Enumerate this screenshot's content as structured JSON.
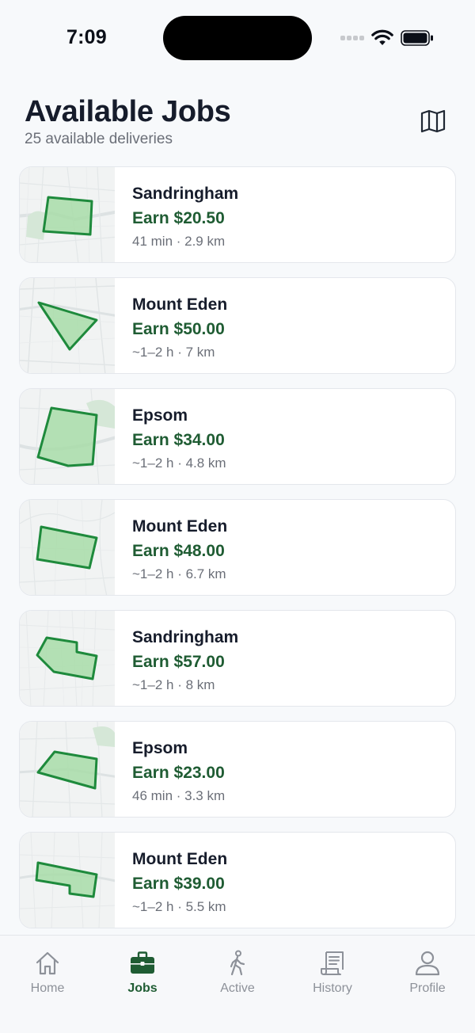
{
  "status_bar": {
    "time": "7:09"
  },
  "header": {
    "title": "Available Jobs",
    "subtitle": "25 available deliveries"
  },
  "jobs": [
    {
      "area": "Sandringham",
      "earn": "Earn $20.50",
      "meta": "41 min · 2.9 km"
    },
    {
      "area": "Mount Eden",
      "earn": "Earn $50.00",
      "meta": "~1–2 h · 7 km"
    },
    {
      "area": "Epsom",
      "earn": "Earn $34.00",
      "meta": "~1–2 h · 4.8 km"
    },
    {
      "area": "Mount Eden",
      "earn": "Earn $48.00",
      "meta": "~1–2 h · 6.7 km"
    },
    {
      "area": "Sandringham",
      "earn": "Earn $57.00",
      "meta": "~1–2 h · 8 km"
    },
    {
      "area": "Epsom",
      "earn": "Earn $23.00",
      "meta": "46 min · 3.3 km"
    },
    {
      "area": "Mount Eden",
      "earn": "Earn $39.00",
      "meta": "~1–2 h · 5.5 km"
    }
  ],
  "tabs": [
    {
      "label": "Home",
      "icon": "home-icon"
    },
    {
      "label": "Jobs",
      "icon": "briefcase-icon",
      "active": true
    },
    {
      "label": "Active",
      "icon": "walking-person-icon"
    },
    {
      "label": "History",
      "icon": "receipt-icon"
    },
    {
      "label": "Profile",
      "icon": "person-icon"
    }
  ],
  "colors": {
    "accent": "#1f5c33",
    "zone_fill": "#a8dca8",
    "zone_stroke": "#1e8a3c",
    "text_primary": "#161c2b",
    "text_secondary": "#6b6f78",
    "tab_inactive": "#8d9199"
  }
}
